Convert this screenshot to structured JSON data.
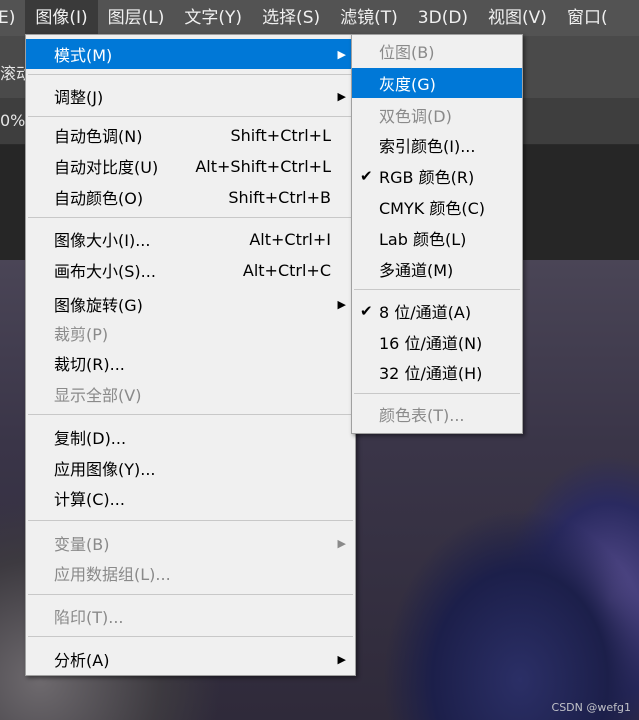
{
  "menubar": {
    "items": [
      {
        "label": "E)"
      },
      {
        "label": "图像(I)"
      },
      {
        "label": "图层(L)"
      },
      {
        "label": "文字(Y)"
      },
      {
        "label": "选择(S)"
      },
      {
        "label": "滤镜(T)"
      },
      {
        "label": "3D(D)"
      },
      {
        "label": "视图(V)"
      },
      {
        "label": "窗口("
      }
    ]
  },
  "peek": {
    "options_text": "滚动",
    "tab_text": "0%("
  },
  "image_menu": {
    "items": [
      {
        "label": "模式(M)",
        "has_submenu": true,
        "highlighted": true
      },
      {
        "label": "调整(J)",
        "has_submenu": true
      },
      {
        "label": "自动色调(N)",
        "shortcut": "Shift+Ctrl+L"
      },
      {
        "label": "自动对比度(U)",
        "shortcut": "Alt+Shift+Ctrl+L"
      },
      {
        "label": "自动颜色(O)",
        "shortcut": "Shift+Ctrl+B"
      },
      {
        "label": "图像大小(I)...",
        "shortcut": "Alt+Ctrl+I"
      },
      {
        "label": "画布大小(S)...",
        "shortcut": "Alt+Ctrl+C"
      },
      {
        "label": "图像旋转(G)",
        "has_submenu": true
      },
      {
        "label": "裁剪(P)",
        "disabled": true
      },
      {
        "label": "裁切(R)..."
      },
      {
        "label": "显示全部(V)",
        "disabled": true
      },
      {
        "label": "复制(D)..."
      },
      {
        "label": "应用图像(Y)..."
      },
      {
        "label": "计算(C)..."
      },
      {
        "label": "变量(B)",
        "has_submenu": true,
        "disabled": true
      },
      {
        "label": "应用数据组(L)...",
        "disabled": true
      },
      {
        "label": "陷印(T)...",
        "disabled": true
      },
      {
        "label": "分析(A)",
        "has_submenu": true
      }
    ]
  },
  "mode_submenu": {
    "items": [
      {
        "label": "位图(B)",
        "disabled": true
      },
      {
        "label": "灰度(G)",
        "highlighted": true
      },
      {
        "label": "双色调(D)",
        "disabled": true
      },
      {
        "label": "索引颜色(I)..."
      },
      {
        "label": "RGB 颜色(R)",
        "checked": true
      },
      {
        "label": "CMYK 颜色(C)"
      },
      {
        "label": "Lab 颜色(L)"
      },
      {
        "label": "多通道(M)"
      },
      {
        "label": "8 位/通道(A)",
        "checked": true
      },
      {
        "label": "16 位/通道(N)"
      },
      {
        "label": "32 位/通道(H)"
      },
      {
        "label": "颜色表(T)...",
        "disabled": true
      }
    ]
  },
  "glyphs": {
    "arrow": "▶",
    "check": "✔"
  },
  "colors": {
    "highlight": "#0078d7",
    "menu_bg": "#f0f0f0",
    "menubar_bg": "#535353"
  },
  "watermark": "CSDN @wefg1"
}
